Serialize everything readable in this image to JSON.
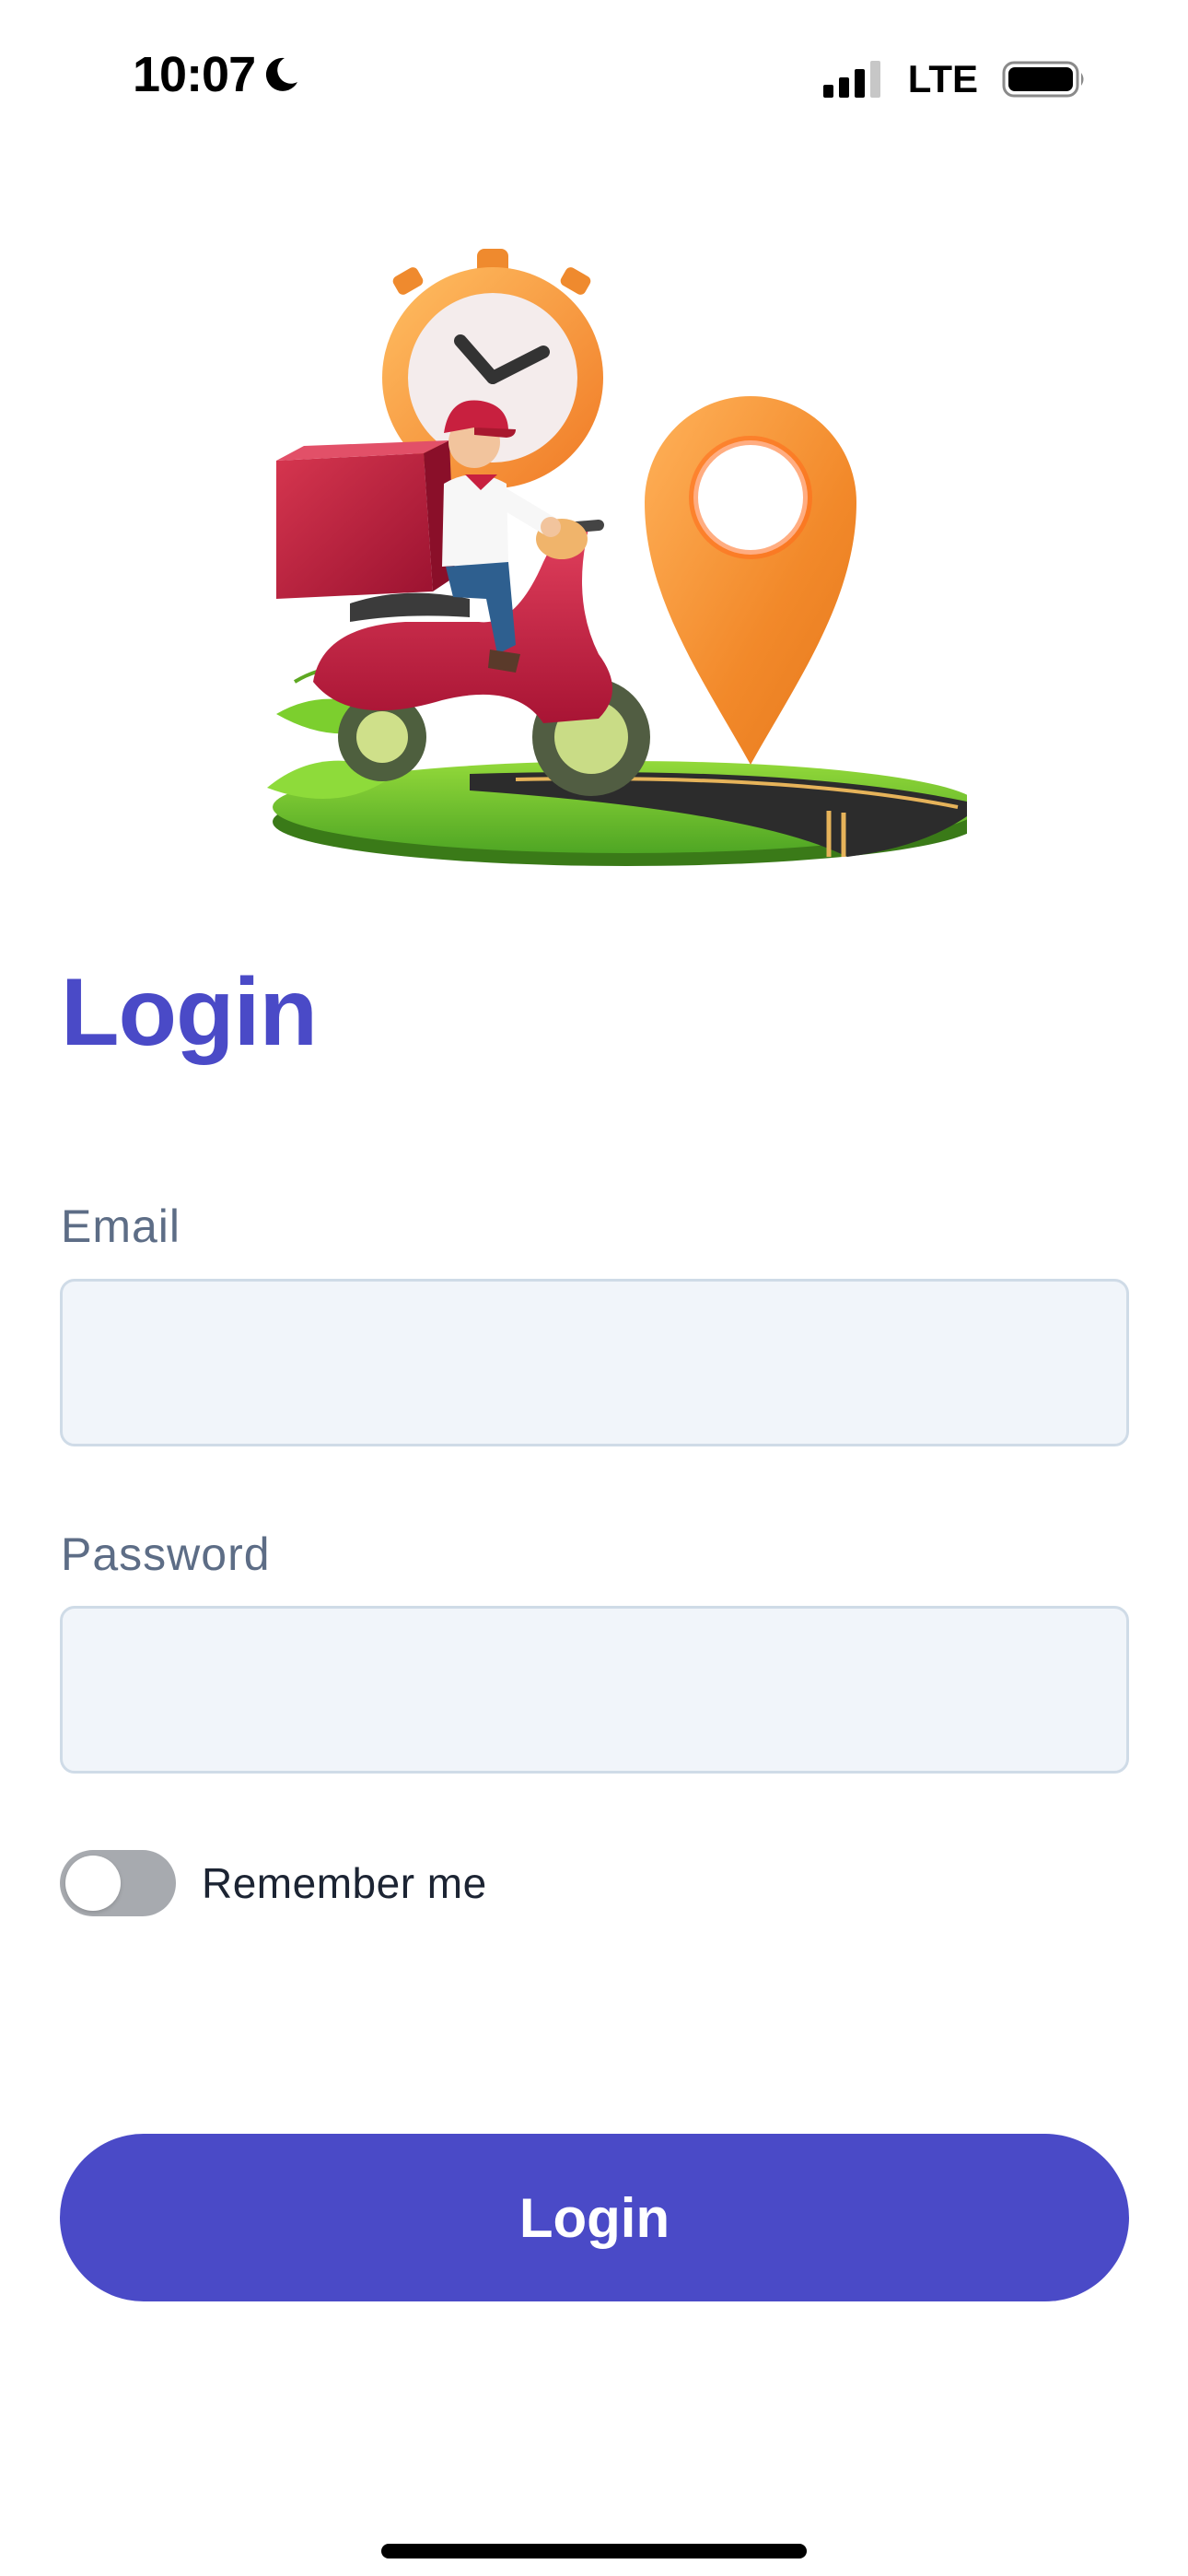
{
  "status_bar": {
    "time": "10:07",
    "network": "LTE",
    "icons": [
      "moon-icon",
      "signal-icon",
      "battery-icon"
    ]
  },
  "hero": {
    "illustration": "delivery-scooter-illustration",
    "elements": [
      "stopwatch-icon",
      "location-pin-icon",
      "delivery-rider",
      "road-platform"
    ]
  },
  "login": {
    "title": "Login",
    "email_label": "Email",
    "email_value": "",
    "password_label": "Password",
    "password_value": "",
    "remember_label": "Remember me",
    "remember_on": false,
    "button_label": "Login"
  },
  "colors": {
    "accent": "#4a4ac7",
    "field_bg": "#f1f5fa",
    "field_border": "#cfdbe7",
    "label": "#5d6d86",
    "toggle_off": "#a7aaaf"
  }
}
